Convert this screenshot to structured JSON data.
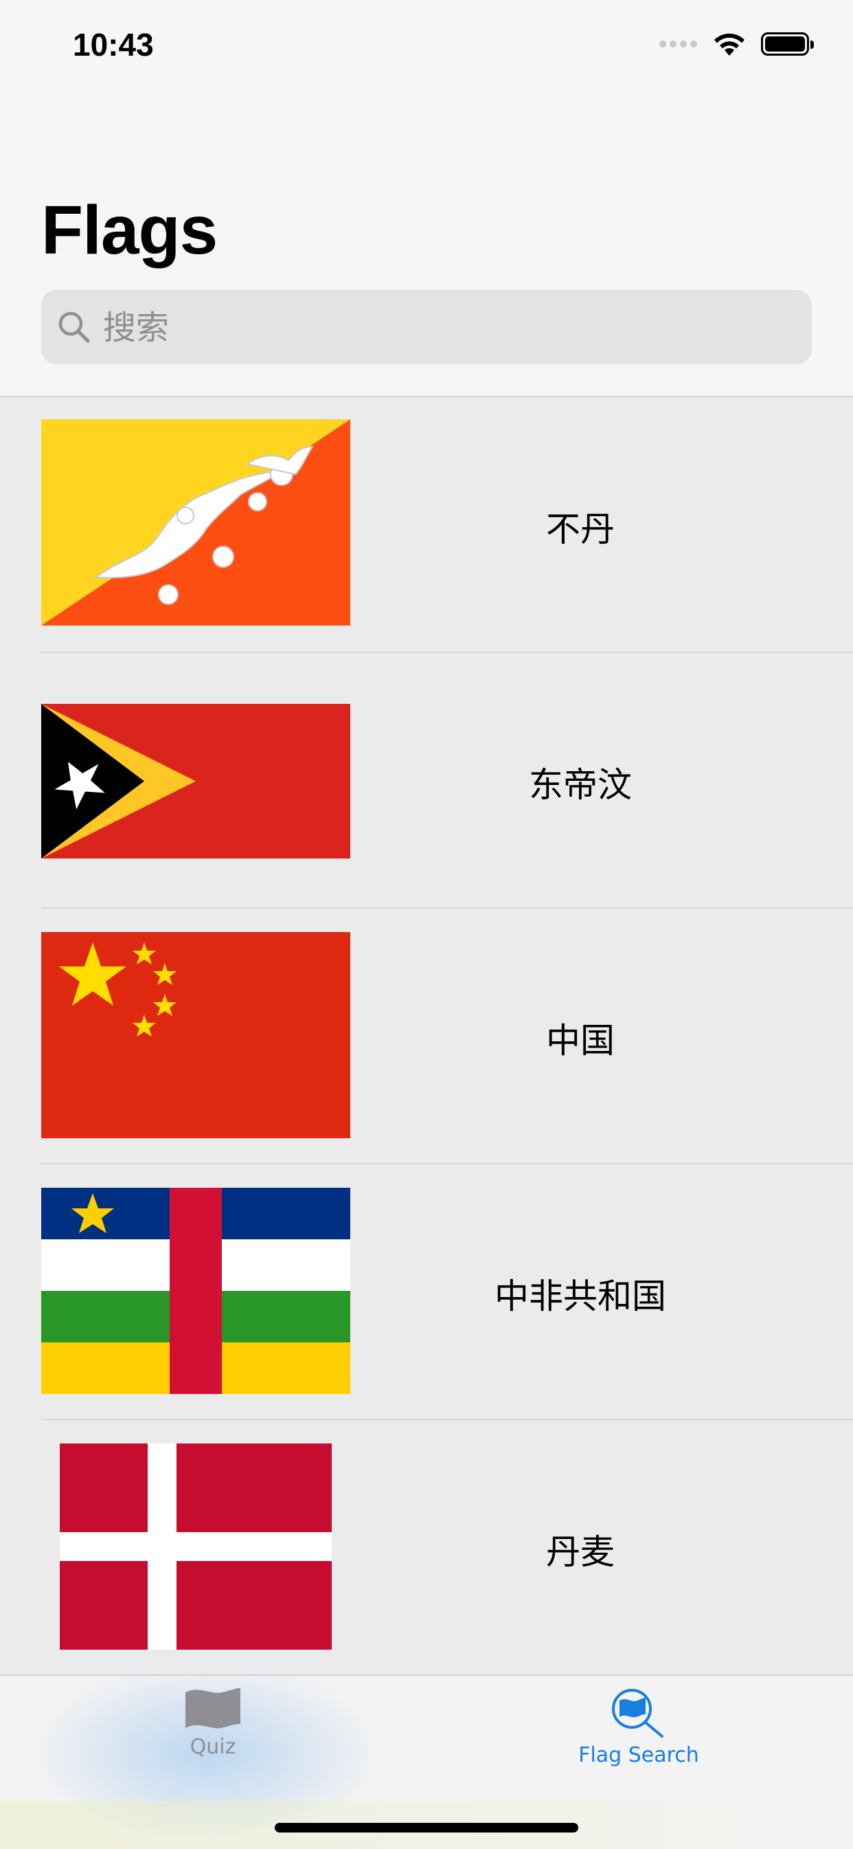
{
  "status_bar": {
    "time": "10:43"
  },
  "header": {
    "title": "Flags"
  },
  "search": {
    "placeholder": "搜索"
  },
  "countries": [
    {
      "name": "不丹",
      "flag": "bhutan"
    },
    {
      "name": "东帝汶",
      "flag": "timor-leste"
    },
    {
      "name": "中国",
      "flag": "china"
    },
    {
      "name": "中非共和国",
      "flag": "central-african-republic"
    },
    {
      "name": "丹麦",
      "flag": "denmark"
    }
  ],
  "tab_bar": {
    "tabs": [
      {
        "label": "Quiz",
        "icon": "flag-icon",
        "active": false
      },
      {
        "label": "Flag Search",
        "icon": "flag-search-icon",
        "active": true
      }
    ]
  },
  "colors": {
    "accent": "#1a7ee0",
    "inactive": "#8e8e93"
  }
}
